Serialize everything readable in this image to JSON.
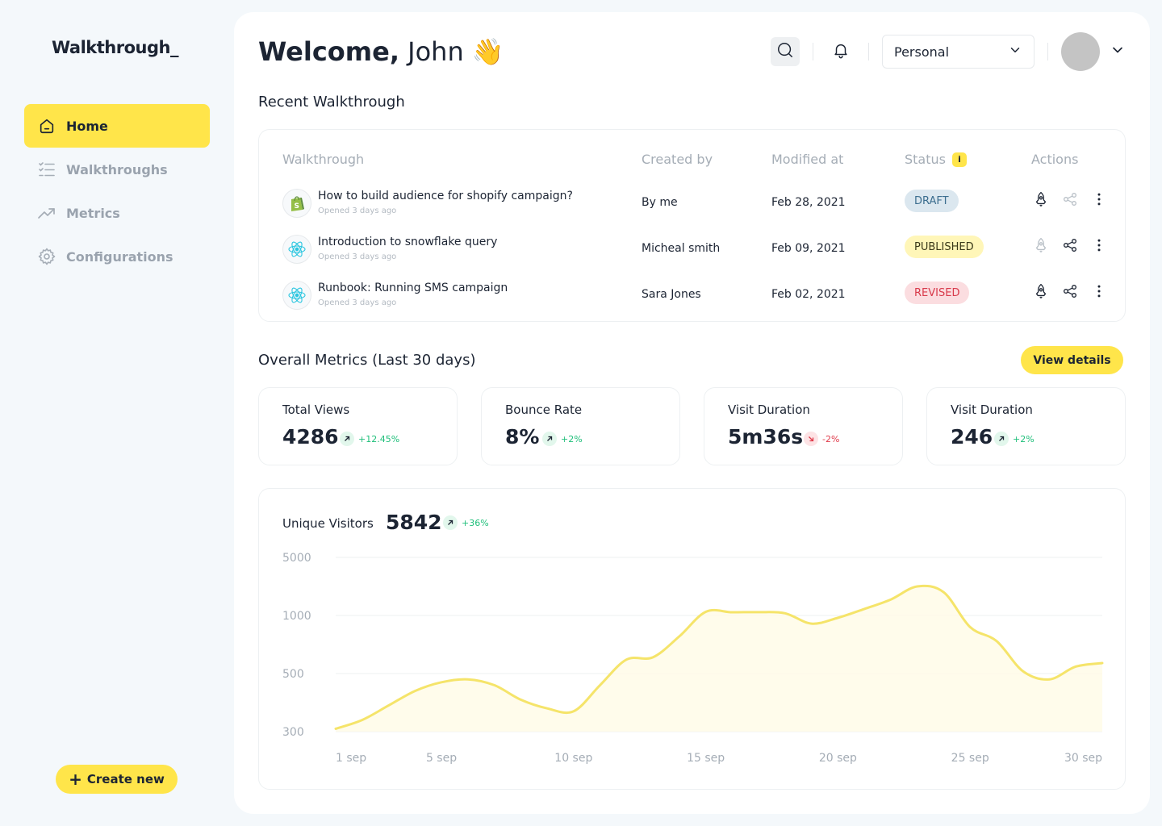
{
  "brand": {
    "logo": "Walkthrough_"
  },
  "sidebar": {
    "items": [
      {
        "label": "Home",
        "icon": "home-icon",
        "active": true
      },
      {
        "label": "Walkthroughs",
        "icon": "checklist-icon",
        "active": false
      },
      {
        "label": "Metrics",
        "icon": "trending-up-icon",
        "active": false
      },
      {
        "label": "Configurations",
        "icon": "gear-icon",
        "active": false
      }
    ],
    "create_label": "Create new"
  },
  "header": {
    "welcome_prefix": "Welcome,",
    "user_name": "John",
    "wave": "👋",
    "workspace": "Personal"
  },
  "recent": {
    "title": "Recent Walkthrough",
    "columns": [
      "Walkthrough",
      "Created by",
      "Modified at",
      "Status",
      "Actions"
    ],
    "status_info_badge": "i",
    "rows": [
      {
        "title": "How to build audience for shopify campaign?",
        "subtitle": "Opened 3 days ago",
        "icon": "shopify-icon",
        "created_by": "By me",
        "modified": "Feb 28, 2021",
        "status": "DRAFT",
        "status_kind": "draft",
        "launch_enabled": true,
        "share_enabled": false
      },
      {
        "title": "Introduction to snowflake query",
        "subtitle": "Opened 3 days ago",
        "icon": "react-icon",
        "created_by": "Micheal smith",
        "modified": "Feb 09, 2021",
        "status": "PUBLISHED",
        "status_kind": "published",
        "launch_enabled": false,
        "share_enabled": true
      },
      {
        "title": "Runbook: Running SMS campaign",
        "subtitle": "Opened 3 days ago",
        "icon": "react-icon",
        "created_by": "Sara Jones",
        "modified": "Feb 02, 2021",
        "status": "REVISED",
        "status_kind": "revised",
        "launch_enabled": true,
        "share_enabled": true
      }
    ]
  },
  "metrics": {
    "title": "Overall Metrics (Last 30 days)",
    "view_details": "View details",
    "cards": [
      {
        "label": "Total Views",
        "value": "4286",
        "trend": "+12.45%",
        "direction": "up"
      },
      {
        "label": "Bounce Rate",
        "value": "8%",
        "trend": "+2%",
        "direction": "up"
      },
      {
        "label": "Visit Duration",
        "value": "5m36s",
        "trend": "-2%",
        "direction": "down"
      },
      {
        "label": "Visit Duration",
        "value": "246",
        "trend": "+2%",
        "direction": "up"
      }
    ]
  },
  "colors": {
    "accent": "#ffe54a",
    "up": "#1fbf7a",
    "down": "#e03b4b",
    "text": "#1c2433"
  },
  "chart_data": {
    "type": "area",
    "title": "Unique Visitors",
    "total": "5842",
    "trend": "+36%",
    "trend_direction": "up",
    "y_ticks": [
      "5000",
      "1000",
      "500",
      "300"
    ],
    "x_ticks": [
      "1 sep",
      "5 sep",
      "10 sep",
      "15 sep",
      "20 sep",
      "25 sep",
      "30 sep"
    ],
    "x": [
      1,
      2,
      3,
      4,
      5,
      6,
      7,
      8,
      9,
      10,
      11,
      12,
      13,
      14,
      15,
      16,
      17,
      18,
      19,
      20,
      21,
      22,
      23,
      24,
      25,
      26,
      27,
      28,
      29,
      30
    ],
    "values": [
      310,
      340,
      390,
      440,
      470,
      480,
      460,
      410,
      380,
      370,
      460,
      620,
      640,
      820,
      1250,
      1220,
      1230,
      1150,
      930,
      980,
      1450,
      2100,
      3000,
      2600,
      900,
      780,
      520,
      480,
      560,
      590
    ],
    "grid": true,
    "color": "#f5e46a"
  }
}
